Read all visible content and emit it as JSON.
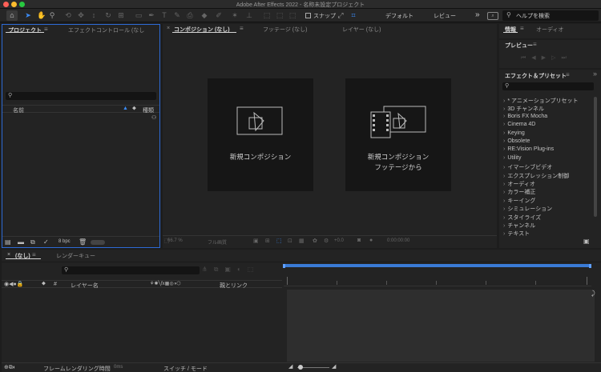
{
  "window": {
    "title": "Adobe After Effects 2022 - 名称未設定プロジェクト"
  },
  "toolbar": {
    "snap_label": "スナップ",
    "workspace_default": "デフォルト",
    "workspace_review": "レビュー",
    "more": "»",
    "search_placeholder": "ヘルプを検索"
  },
  "project_panel": {
    "tab_project": "プロジェクト",
    "tab_effect_controls": "エフェクトコントロール (なし",
    "col_name": "名前",
    "col_type": "種類",
    "bpc": "8 bpc"
  },
  "comp_panel": {
    "tab_comp": "コンポジション (なし)",
    "tab_footage": "フッテージ (なし)",
    "tab_layer": "レイヤー (なし)",
    "card_new_comp": "新規コンポジション",
    "card_from_footage_line1": "新規コンポジション",
    "card_from_footage_line2": "フッテージから",
    "zoom": "66.7 %",
    "quality": "フル画質",
    "exposure": "+0.0",
    "timecode": "0:00:00:00"
  },
  "info_panel": {
    "tab_info": "情報",
    "tab_audio": "オーディオ",
    "preview_title": "プレビュー",
    "effects_title": "エフェクト＆プリセット",
    "effects_items": [
      "* アニメーションプリセット",
      "3D チャンネル",
      "Boris FX Mocha",
      "Cinema 4D",
      "Keying",
      "Obsolete",
      "RE:Vision Plug-ins",
      "Utility",
      "イマーシブビデオ",
      "エクスプレッション制御",
      "オーディオ",
      "カラー補正",
      "キーイング",
      "シミュレーション",
      "スタイライズ",
      "チャンネル",
      "テキスト"
    ]
  },
  "timeline_panel": {
    "tab_none": "(なし)",
    "tab_render_queue": "レンダーキュー",
    "col_hash": "#",
    "col_layer_name": "レイヤー名",
    "col_parent": "親とリンク",
    "footer_render_time": "フレームレンダリング時間",
    "footer_ms": "0ms",
    "footer_switches": "スイッチ / モード"
  },
  "colors": {
    "accent": "#2d6bd6",
    "time_bar": "#3a7bd5"
  }
}
